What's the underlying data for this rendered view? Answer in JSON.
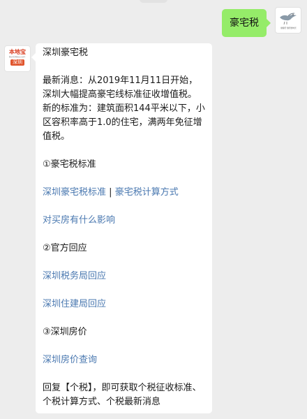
{
  "outgoing": {
    "text": "豪宅税"
  },
  "brand": {
    "name": "本地宝",
    "url": "BenDiBao.com",
    "city": "深圳"
  },
  "user_avatar": {
    "caption": "健康行 旅行的时光"
  },
  "reply": {
    "title": "深圳豪宅税",
    "news": "最新消息：从2019年11月11日开始，深圳大幅提高豪宅线标准征收增值税。新的标准为：建筑面积144平米以下，小区容积率高于1.0的住宅，满两年免征增值税。",
    "section1": "①豪宅税标准",
    "link_standard": "深圳豪宅税标准",
    "separator": "|",
    "link_calc": "豪宅税计算方式",
    "link_impact": "对买房有什么影响",
    "section2": "②官方回应",
    "link_tax_bureau": "深圳税务局回应",
    "link_housing_bureau": "深圳住建局回应",
    "section3": "③深圳房价",
    "link_price": "深圳房价查询",
    "footer": "回复【个税】，即可获取个税征收标准、个税计算方式、个税最新消息"
  }
}
